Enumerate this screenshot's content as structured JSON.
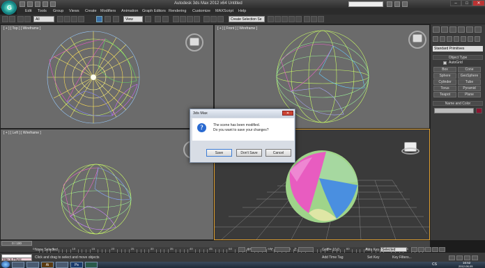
{
  "window": {
    "title": "Autodesk 3ds Max  2012 x64       Untitled",
    "help_placeholder": "",
    "min": "–",
    "max": "□",
    "close": "✕"
  },
  "menu": [
    "Edit",
    "Tools",
    "Group",
    "Views",
    "Create",
    "Modifiers",
    "Animation",
    "Graph Editors",
    "Rendering",
    "Customize",
    "MAXScript",
    "Help"
  ],
  "toolbar": {
    "selection_filter": "All",
    "coord_system": "View",
    "named_selection": "Create Selection Se"
  },
  "viewports": {
    "top": "[ + ] [ Top ] [ Wireframe ]",
    "front": "[ + ] [ Front ] [ Wireframe ]",
    "left": "[ + ] [ Left ] [ Wireframe ]",
    "perspective": ""
  },
  "command_panel": {
    "category": "Standard Primitives",
    "object_type_title": "Object Type",
    "autogrid": "AutoGrid",
    "buttons": [
      "Box",
      "Cone",
      "Sphere",
      "GeoSphere",
      "Cylinder",
      "Tube",
      "Torus",
      "Pyramid",
      "Teapot",
      "Plane"
    ],
    "name_color_title": "Name and Color"
  },
  "dialog": {
    "title": "3ds Max",
    "close": "✕",
    "icon": "?",
    "line1": "The scene has been modified.",
    "line2": "Do you want to save your changes?",
    "buttons": [
      "Save",
      "Don't Save",
      "Cancel"
    ]
  },
  "timeline": {
    "frame_label": "0 / 100",
    "ticks": [
      "0",
      "5",
      "10",
      "15",
      "20",
      "25",
      "30",
      "35",
      "40",
      "45",
      "50",
      "55",
      "60",
      "65",
      "70",
      "75",
      "80",
      "85",
      "90",
      "95",
      "100"
    ]
  },
  "status": {
    "listener": "Max to Physc",
    "selection": "None Selected",
    "prompt": "Click and drag to select and move objects",
    "grid": "Grid = 10,0",
    "add_time_tag": "Add Time Tag",
    "auto_key": "Auto Key",
    "key_mode": "Selected",
    "set_key": "Set Key",
    "key_filters": "Key Filters...",
    "coords": {
      "x": "X:",
      "y": "Y:",
      "z": "Z:"
    }
  },
  "taskbar": {
    "apps": [
      "",
      "",
      "Ai",
      "",
      "Ps",
      ""
    ],
    "lang": "CS",
    "time": "16:52",
    "date": "2012-06-05"
  },
  "colors": {
    "accent": "#e0a030",
    "dialog_button_focus": "#3a7bd5",
    "object_color": "#8a1530"
  }
}
